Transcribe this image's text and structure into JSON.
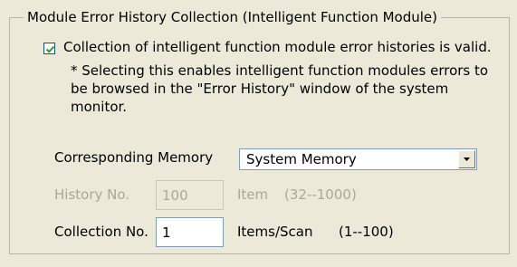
{
  "group": {
    "title": "Module Error History Collection (Intelligent Function Module)"
  },
  "checkbox": {
    "checked": true,
    "label": "Collection of intelligent function module error histories is valid."
  },
  "note": "* Selecting this enables intelligent function modules errors to be browsed in the \"Error History\" window of the system monitor.",
  "memory": {
    "label": "Corresponding Memory",
    "selected": "System Memory"
  },
  "history": {
    "label": "History No.",
    "value": "100",
    "unit": "Item",
    "range": "(32--1000)"
  },
  "collection": {
    "label": "Collection No.",
    "value": "1",
    "unit": "Items/Scan",
    "range": "(1--100)"
  }
}
